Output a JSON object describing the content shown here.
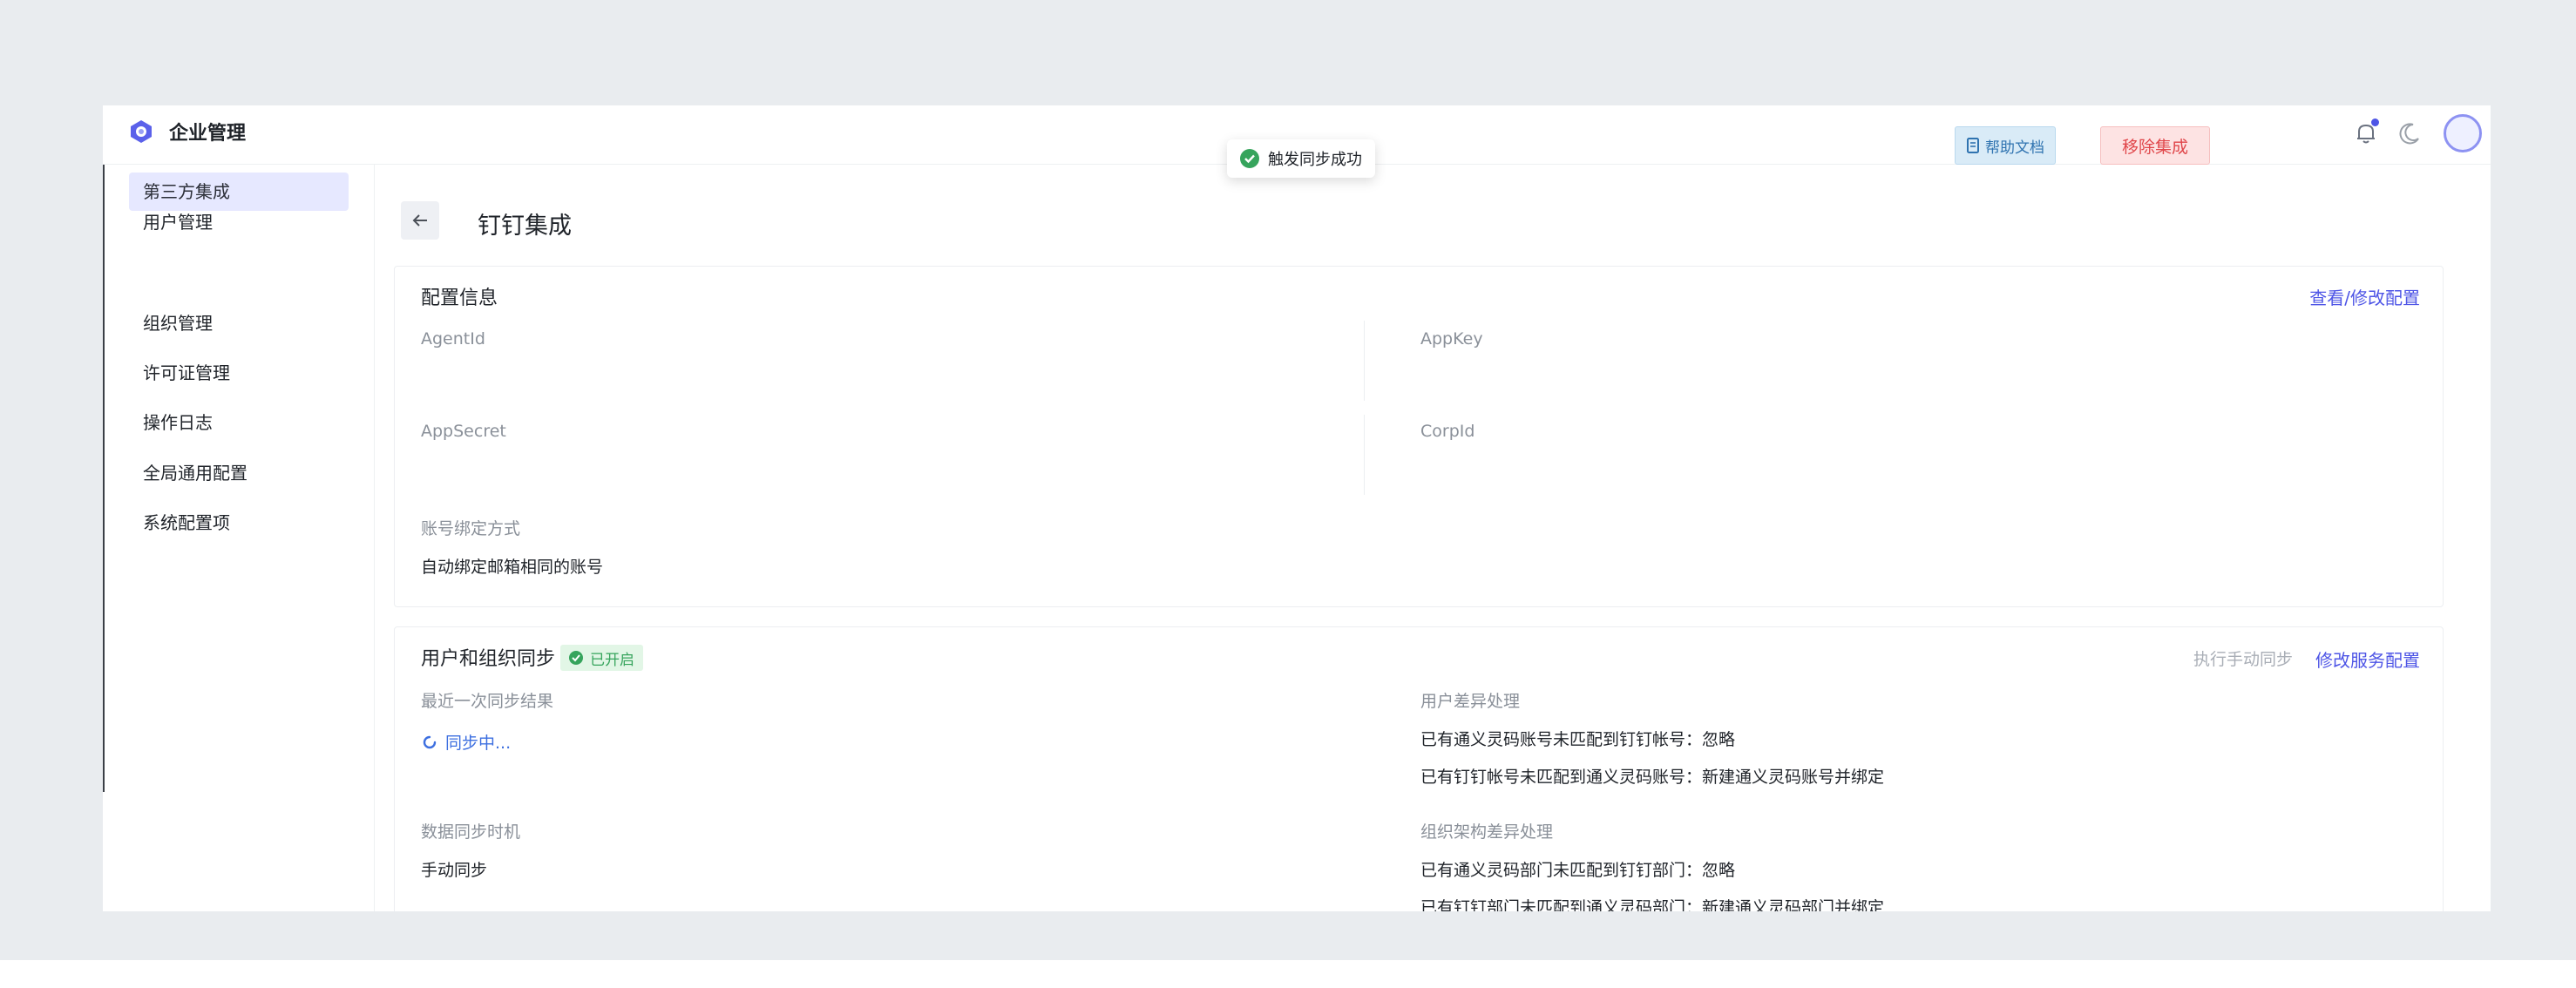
{
  "app": {
    "title": "企业管理"
  },
  "sidebar": {
    "items": [
      {
        "label": "用户管理",
        "active": false
      },
      {
        "label": "第三方集成",
        "active": true
      },
      {
        "label": "组织管理",
        "active": false
      },
      {
        "label": "许可证管理",
        "active": false
      },
      {
        "label": "操作日志",
        "active": false
      },
      {
        "label": "全局通用配置",
        "active": false
      },
      {
        "label": "系统配置项",
        "active": false
      }
    ]
  },
  "toast": {
    "message": "触发同步成功"
  },
  "page": {
    "title": "钉钉集成",
    "help_label": "帮助文档",
    "remove_label": "移除集成"
  },
  "config": {
    "title": "配置信息",
    "edit_link": "查看/修改配置",
    "fields": {
      "agent_id_label": "AgentId",
      "app_key_label": "AppKey",
      "app_secret_label": "AppSecret",
      "corp_id_label": "CorpId",
      "binding_label": "账号绑定方式",
      "binding_value": "自动绑定邮箱相同的账号"
    }
  },
  "sync": {
    "title": "用户和组织同步",
    "status_badge": "已开启",
    "manual_sync_label": "执行手动同步",
    "edit_service_link": "修改服务配置",
    "last_result_label": "最近一次同步结果",
    "last_result_value": "同步中...",
    "user_diff_label": "用户差异处理",
    "user_diff_1": "已有通义灵码账号未匹配到钉钉帐号：忽略",
    "user_diff_2": "已有钉钉帐号未匹配到通义灵码账号：新建通义灵码账号并绑定",
    "timing_label": "数据同步时机",
    "timing_value": "手动同步",
    "org_diff_label": "组织架构差异处理",
    "org_diff_1": "已有通义灵码部门未匹配到钉钉部门：忽略",
    "org_diff_2": "已有钉钉部门未匹配到通义灵码部门：新建通义灵码部门并绑定"
  },
  "colors": {
    "accent": "#4e55e6",
    "danger": "#e0464a",
    "success": "#36a45c",
    "sidebar_active_bg": "#e6e8ff"
  },
  "icons": [
    "app-logo-icon",
    "bell-icon",
    "moon-icon",
    "back-arrow-icon",
    "doc-icon",
    "check-circle-icon",
    "spinner-icon"
  ]
}
